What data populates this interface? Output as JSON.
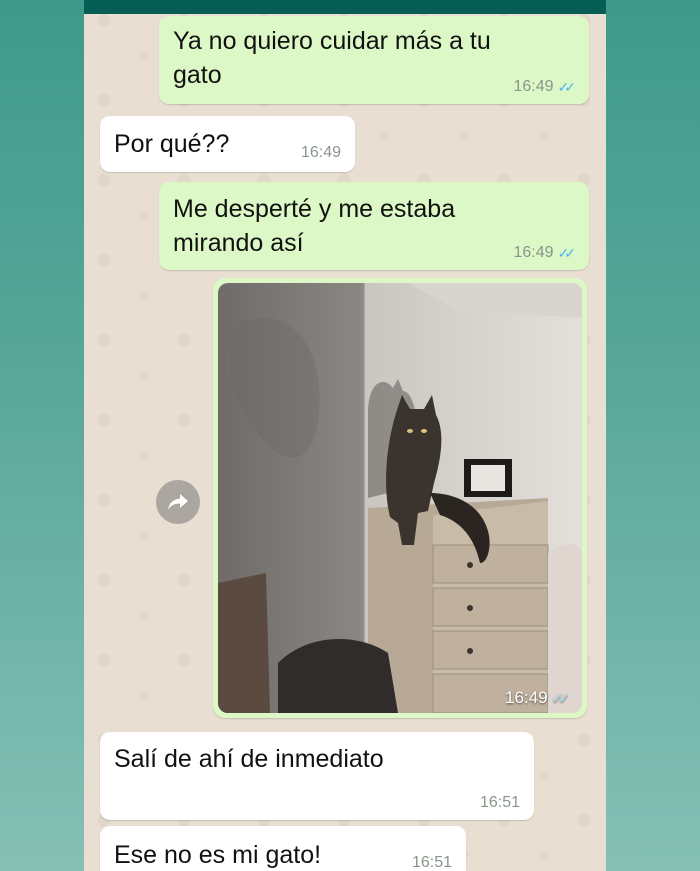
{
  "chat": {
    "messages": [
      {
        "direction": "outgoing",
        "text_line1": "Ya no quiero cuidar más a tu",
        "text_line2": "gato",
        "time": "16:49",
        "status": "read"
      },
      {
        "direction": "incoming",
        "text_line1": "Por qué??",
        "time": "16:49"
      },
      {
        "direction": "outgoing",
        "text_line1": "Me desperté y me estaba",
        "text_line2": "mirando así",
        "time": "16:49",
        "status": "read"
      },
      {
        "direction": "outgoing",
        "type": "image",
        "time": "16:49",
        "status": "read",
        "icon": "cat-photo"
      },
      {
        "direction": "incoming",
        "text_line1": "Salí de ahí de inmediato",
        "time": "16:51"
      },
      {
        "direction": "incoming",
        "text_line1": "Ese no es mi gato!",
        "time": "16:51"
      }
    ]
  },
  "icons": {
    "forward": "forward-arrow-icon",
    "read_receipt": "double-check-icon"
  },
  "colors": {
    "outgoing_bubble": "#dcf8c6",
    "incoming_bubble": "#ffffff",
    "header": "#075e54",
    "read_ticks": "#4fb6ec"
  }
}
